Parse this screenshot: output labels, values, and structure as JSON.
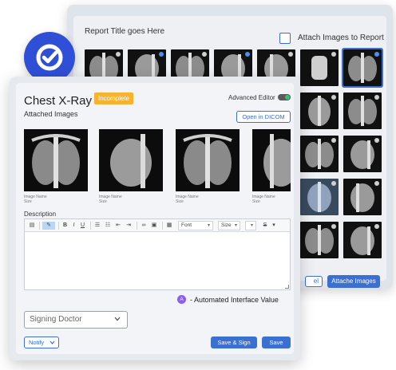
{
  "back_panel": {
    "report_title": "Report Title goes Here",
    "attach_label": "Attach Images to Report",
    "cancel_label": "el",
    "attach_button": "Attache Images"
  },
  "front_panel": {
    "title": "Chest X-Ray",
    "status": "Incomplete",
    "advanced_editor": "Advanced Editor",
    "attached_images_label": "Attached Images",
    "open_dicom": "Open in DICOM",
    "images": [
      {
        "name": "Image Name",
        "size": "Size"
      },
      {
        "name": "Image Name",
        "size": "Size"
      },
      {
        "name": "Image Name",
        "size": "Size"
      },
      {
        "name": "Image Name",
        "size": "Size"
      }
    ],
    "description_label": "Description",
    "toolbar": {
      "font": "Font",
      "size": "Size"
    },
    "automated_badge": "A",
    "automated_text": "- Automated Interface Value",
    "signing_doctor": "Signing Doctor",
    "notify": "Notify",
    "save_sign": "Save & Sign",
    "save": "Save"
  },
  "colors": {
    "accent": "#3b6fd1",
    "badge": "#2f4fd6",
    "status": "#f5b32f",
    "automated": "#8b5cf6"
  }
}
